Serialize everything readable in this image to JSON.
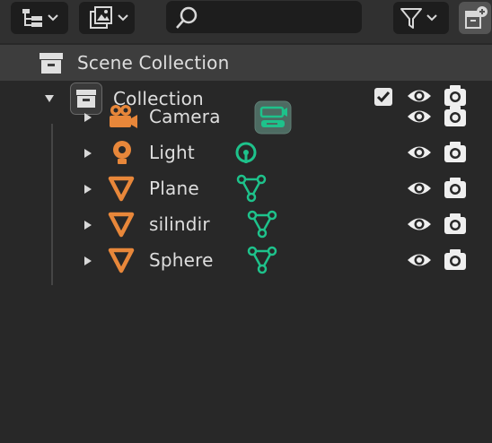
{
  "header": {
    "display_mode_icon": "outliner-display-mode-icon",
    "filter_dropdown_icon": "view-layer-icon",
    "search": {
      "value": "",
      "placeholder": ""
    },
    "filter_icon": "funnel-icon",
    "new_collection_icon": "new-collection-icon"
  },
  "tree": {
    "scene": {
      "label": "Scene Collection",
      "icon": "scene-collection-icon"
    },
    "collection": {
      "label": "Collection",
      "icon": "collection-icon",
      "checked": true
    },
    "objects": [
      {
        "label": "Camera",
        "icon": "camera-object-icon",
        "data_icon": "camera-data-icon"
      },
      {
        "label": "Light",
        "icon": "light-object-icon",
        "data_icon": "light-data-icon"
      },
      {
        "label": "Plane",
        "icon": "mesh-object-icon",
        "data_icon": "mesh-data-icon"
      },
      {
        "label": "silindir",
        "icon": "mesh-object-icon",
        "data_icon": "mesh-data-icon"
      },
      {
        "label": "Sphere",
        "icon": "mesh-object-icon",
        "data_icon": "mesh-data-icon"
      }
    ]
  },
  "colors": {
    "background": "#282828",
    "header": "#303030",
    "selected_row": "#3d3d3d",
    "object_orange": "#e8873a",
    "data_green": "#1ec28b",
    "text": "#dedede"
  }
}
